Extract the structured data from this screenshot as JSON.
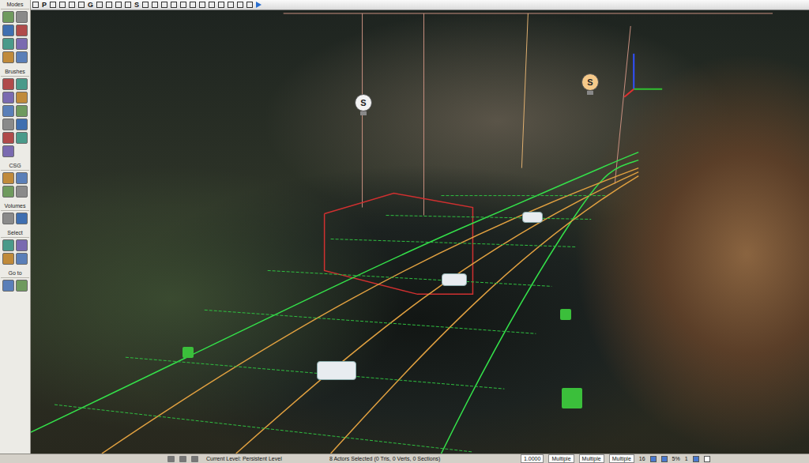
{
  "toolbar": {
    "items": [
      {
        "label": "P"
      },
      {
        "label": "G"
      },
      {
        "label": "S"
      }
    ]
  },
  "sidebar": {
    "sections": [
      {
        "title": "Modes"
      },
      {
        "title": "Brushes"
      },
      {
        "title": "CSG"
      },
      {
        "title": "Volumes"
      },
      {
        "title": "Select"
      },
      {
        "title": "Go to"
      }
    ]
  },
  "viewport": {
    "markers": [
      {
        "label": "S",
        "color": "#f2f2f2"
      },
      {
        "label": "S",
        "color": "#f5c98a"
      }
    ]
  },
  "status_bar": {
    "level": "Current Level: Persistent Level",
    "selection": "8 Actors Selected (0 Tris, 0 Verts, 0 Sections)",
    "fields": [
      "1.0000",
      "Multiple",
      "Multiple",
      "Multiple"
    ],
    "grid": "16",
    "toggles": [
      {
        "checked": true
      },
      {
        "checked": true
      }
    ],
    "zoom": "5%",
    "count": "1",
    "end_toggles": [
      {
        "checked": true
      },
      {
        "checked": false
      }
    ]
  }
}
